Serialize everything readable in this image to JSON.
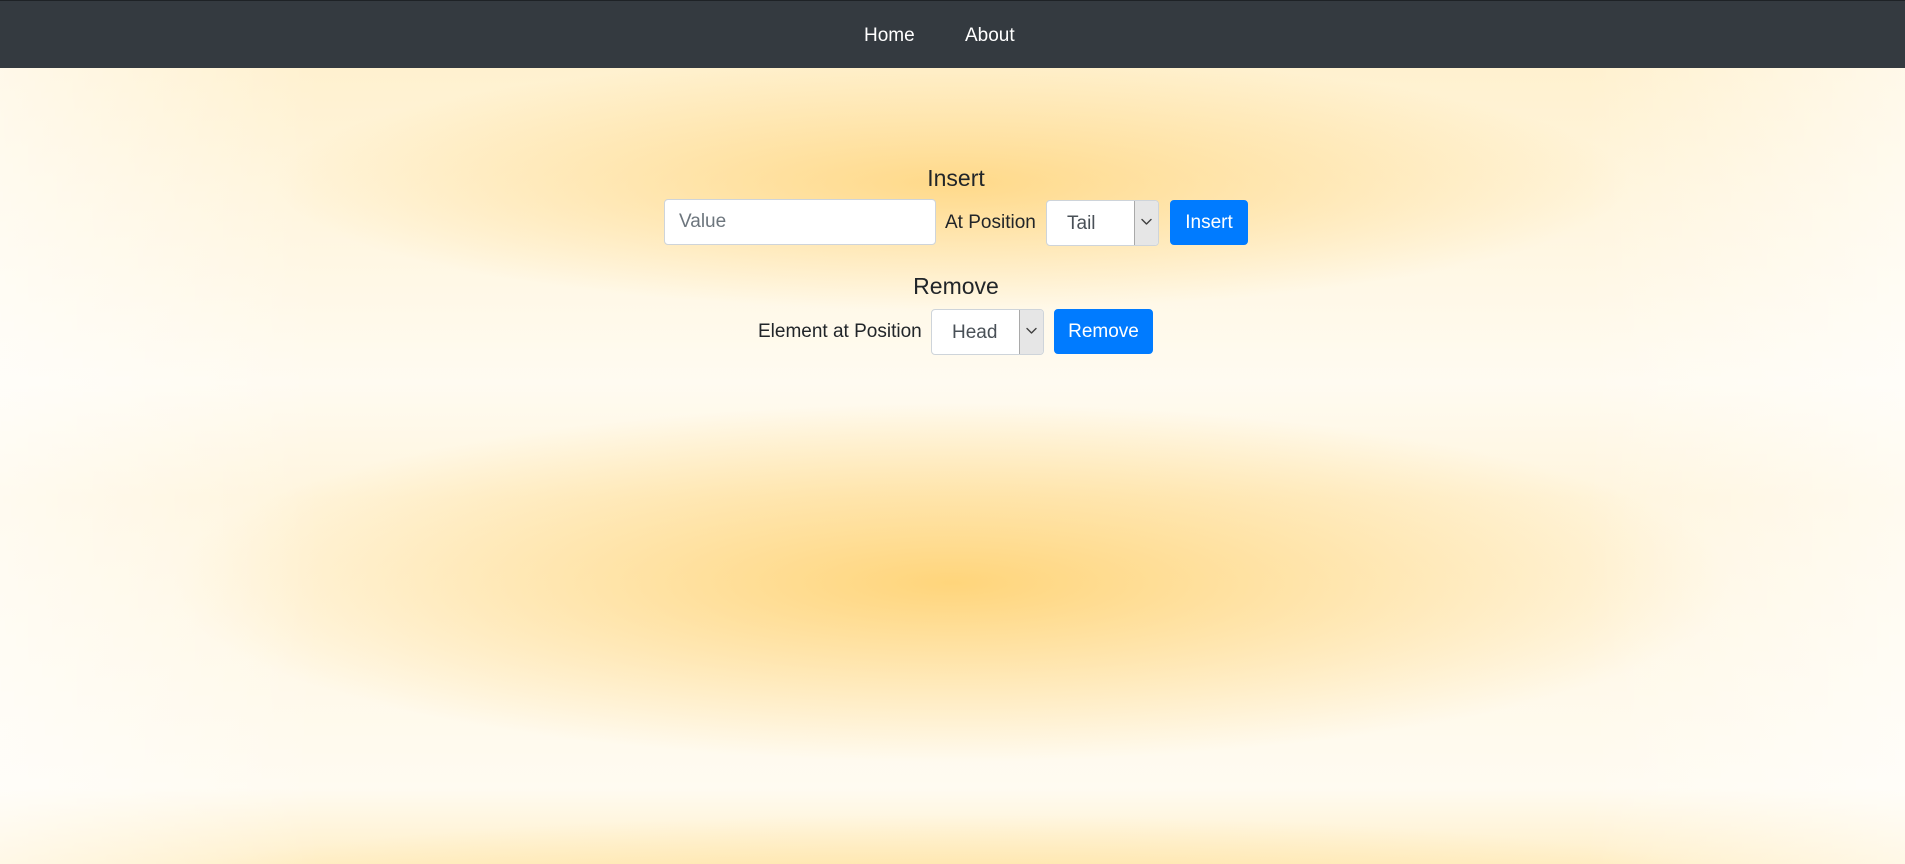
{
  "nav": {
    "items": [
      {
        "label": "Home"
      },
      {
        "label": "About"
      }
    ]
  },
  "insert": {
    "heading": "Insert",
    "value_input": {
      "placeholder": "Value",
      "value": ""
    },
    "position_label": "At Position",
    "position_select": {
      "selected": "Tail",
      "icon": "chevron-down-icon"
    },
    "button_label": "Insert"
  },
  "remove": {
    "heading": "Remove",
    "position_label": "Element at Position",
    "position_select": {
      "selected": "Head",
      "icon": "chevron-down-icon"
    },
    "button_label": "Remove"
  },
  "colors": {
    "navbar": "#343a40",
    "primary": "#007bff",
    "background_accent": "#ffd787"
  }
}
